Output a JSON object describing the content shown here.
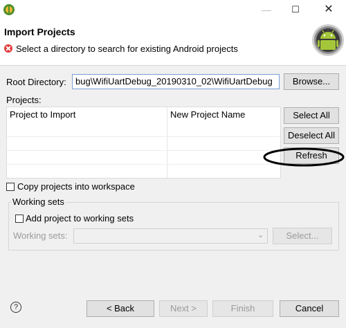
{
  "window": {
    "minimize_glyph": "—",
    "maximize_glyph": "☐",
    "close_glyph": "✕"
  },
  "header": {
    "title": "Import Projects",
    "message": "Select a directory to search for existing Android projects",
    "error_color": "#e03b3b"
  },
  "root": {
    "label": "Root Directory:",
    "value": "bug\\WifiUartDebug_20190310_02\\WifiUartDebug",
    "browse_label": "Browse..."
  },
  "projects": {
    "label": "Projects:",
    "columns": [
      "Project to Import",
      "New Project Name"
    ],
    "rows": [],
    "select_all_label": "Select All",
    "deselect_all_label": "Deselect All",
    "refresh_label": "Refresh"
  },
  "options": {
    "copy_label": "Copy projects into workspace",
    "copy_checked": false
  },
  "working_sets": {
    "legend": "Working sets",
    "add_label": "Add project to working sets",
    "add_checked": false,
    "sets_label": "Working sets:",
    "select_label": "Select..."
  },
  "footer": {
    "help_glyph": "?",
    "back_label": "< Back",
    "next_label": "Next >",
    "finish_label": "Finish",
    "cancel_label": "Cancel"
  },
  "icons": [
    "app-icon",
    "error-icon",
    "android-logo-icon",
    "help-icon",
    "chevron-down-icon"
  ]
}
